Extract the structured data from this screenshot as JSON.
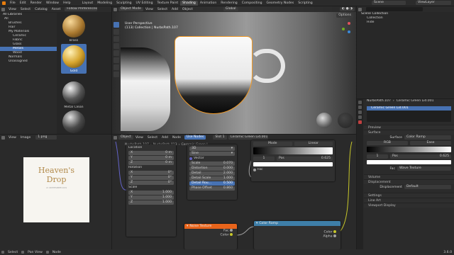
{
  "topbar": {
    "menus": [
      "File",
      "Edit",
      "Render",
      "Window",
      "Help"
    ],
    "tabs": [
      "Layout",
      "Modeling",
      "Sculpting",
      "UV Editing",
      "Texture Paint",
      "Shading",
      "Animation",
      "Rendering",
      "Compositing",
      "Geometry Nodes",
      "Scripting"
    ],
    "active_tab": "Shading",
    "scene": "Scene",
    "view_layer": "ViewLayer"
  },
  "file_browser": {
    "menus": [
      "View",
      "Select",
      "Catalog",
      "Asset"
    ],
    "folder": "Follow Preferences",
    "tree": [
      "All",
      "Brushes",
      "Hair",
      "My Materials",
      "Ceramic",
      "Fabric",
      "Glass",
      "Metals",
      "Wood",
      "Normals",
      "Unassigned"
    ],
    "selected": "Metals",
    "thumbs": [
      "Brass",
      "Gold",
      "Metal Clean",
      "Metal Grainy"
    ]
  },
  "viewport": {
    "mode": "Object Mode",
    "menus": [
      "View",
      "Select",
      "Add",
      "Object"
    ],
    "orientation": "Global",
    "options": "Options",
    "title": "User Perspective",
    "subtitle": "(113) Collection | NurbsPath.107"
  },
  "outliner": {
    "title": "Scene Collection",
    "items": [
      "Collection",
      "Hide"
    ]
  },
  "image_editor": {
    "menus": [
      "View",
      "Image"
    ],
    "image_name": "1.png",
    "card_title": "Heaven's",
    "card_title2": "Drop",
    "card_date": "21 SEPTEMBER 2019"
  },
  "node_editor": {
    "mode": "Object",
    "menus": [
      "View",
      "Select",
      "Add",
      "Node"
    ],
    "use_nodes": "Use Nodes",
    "slot": "Slot 1",
    "material": "Ceramic Green Lid.001",
    "breadcrumb": [
      "NurbsPath.107",
      "NurbsPath.013",
      "Ceramic Green L"
    ],
    "mapping": {
      "location_label": "Location",
      "location": [
        {
          "axis": "X",
          "value": "0 m"
        },
        {
          "axis": "Y",
          "value": "0 m"
        },
        {
          "axis": "Z",
          "value": "0 m"
        }
      ],
      "rotation_label": "Rotation",
      "rotation": [
        {
          "axis": "X",
          "value": "0°"
        },
        {
          "axis": "Y",
          "value": "0°"
        },
        {
          "axis": "Z",
          "value": "0°"
        }
      ],
      "scale_label": "Scale",
      "scale": [
        {
          "axis": "X",
          "value": "1.000"
        },
        {
          "axis": "Y",
          "value": "1.000"
        },
        {
          "axis": "Z",
          "value": "1.000"
        }
      ]
    },
    "noise_node": {
      "dimension": "3D",
      "basis": "Sine",
      "vector_label": "Vector",
      "fields": [
        {
          "label": "Scale",
          "value": "0.070"
        },
        {
          "label": "Distortion",
          "value": "0.000"
        },
        {
          "label": "Detail",
          "value": "2.000"
        },
        {
          "label": "Detail Scale",
          "value": "1.000"
        },
        {
          "label": "Detail Rou...",
          "value": "0.500"
        },
        {
          "label": "Phase Offset",
          "value": "0.860"
        }
      ]
    },
    "noise_texture": {
      "title": "Noise Texture",
      "outputs": [
        "Fac",
        "Color"
      ]
    },
    "ramp_top": {
      "mode": "Mode",
      "interp": "Linear",
      "index": "1",
      "pos_label": "Pos",
      "pos": "0.625",
      "fac": "Fac"
    },
    "color_ramp": {
      "title": "Color Ramp",
      "outputs": [
        "Color",
        "Alpha"
      ]
    }
  },
  "properties": {
    "object": "NurbsPath.107",
    "material": "Ceramic Green Lid.001",
    "slot": "Ceramic Green Lid.001",
    "sections": [
      "Preview",
      "Surface"
    ],
    "surface_label": "Surface",
    "surface_value": "Color Ramp",
    "rgb": "RGB",
    "ease": "Ease",
    "index": "1",
    "pos_label": "Pos",
    "pos": "0.625",
    "fac_label": "Fac",
    "fac_value": "Wave Texture",
    "sections2": [
      "Volume",
      "Displacement"
    ],
    "displacement_label": "Displacement",
    "displacement_value": "Default",
    "sections3": [
      "Settings",
      "Line Art",
      "Viewport Display"
    ]
  },
  "statusbar": {
    "items": [
      "Select",
      "Pan View",
      "Node"
    ],
    "version": "3.6.0"
  }
}
